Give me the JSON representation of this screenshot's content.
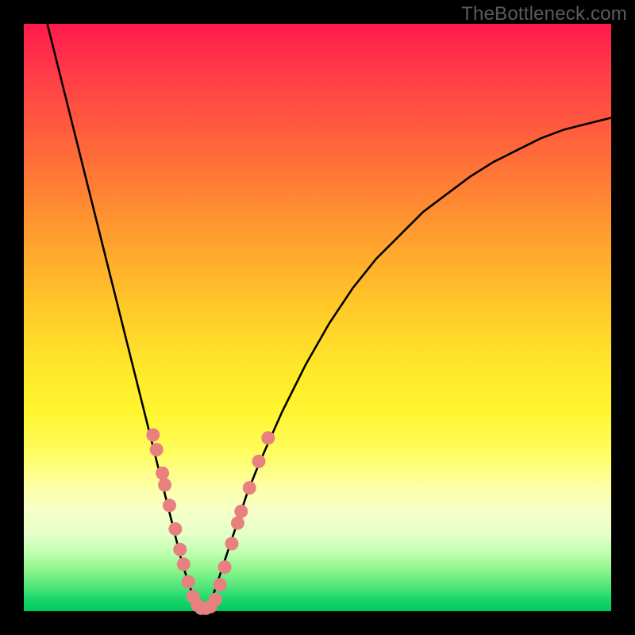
{
  "watermark": "TheBottleneck.com",
  "colors": {
    "frame": "#000000",
    "curve": "#000000",
    "marker_fill": "#e98080",
    "marker_stroke": "#d66a6a"
  },
  "chart_data": {
    "type": "line",
    "title": "",
    "xlabel": "",
    "ylabel": "",
    "xlim": [
      0,
      100
    ],
    "ylim": [
      0,
      100
    ],
    "series": [
      {
        "name": "bottleneck-curve",
        "x": [
          4,
          6,
          8,
          10,
          12,
          14,
          16,
          18,
          20,
          22,
          24,
          26,
          27,
          28,
          29,
          30,
          31,
          32,
          33,
          34,
          36,
          38,
          40,
          44,
          48,
          52,
          56,
          60,
          64,
          68,
          72,
          76,
          80,
          84,
          88,
          92,
          96,
          100
        ],
        "y": [
          100,
          92,
          84,
          76,
          68,
          60,
          52,
          44,
          36,
          28,
          20,
          12,
          8,
          5,
          2,
          0.5,
          0.5,
          2,
          5,
          8,
          14,
          20,
          25,
          34,
          42,
          49,
          55,
          60,
          64,
          68,
          71,
          74,
          76.5,
          78.5,
          80.5,
          82,
          83,
          84
        ]
      }
    ],
    "markers": [
      {
        "x": 22.0,
        "y": 30.0
      },
      {
        "x": 22.6,
        "y": 27.5
      },
      {
        "x": 23.6,
        "y": 23.5
      },
      {
        "x": 24.0,
        "y": 21.5
      },
      {
        "x": 24.8,
        "y": 18.0
      },
      {
        "x": 25.8,
        "y": 14.0
      },
      {
        "x": 26.6,
        "y": 10.5
      },
      {
        "x": 27.2,
        "y": 8.0
      },
      {
        "x": 28.0,
        "y": 5.0
      },
      {
        "x": 28.8,
        "y": 2.5
      },
      {
        "x": 29.6,
        "y": 1.0
      },
      {
        "x": 30.2,
        "y": 0.5
      },
      {
        "x": 31.0,
        "y": 0.5
      },
      {
        "x": 31.8,
        "y": 0.8
      },
      {
        "x": 32.6,
        "y": 2.0
      },
      {
        "x": 33.4,
        "y": 4.5
      },
      {
        "x": 34.2,
        "y": 7.5
      },
      {
        "x": 35.4,
        "y": 11.5
      },
      {
        "x": 36.4,
        "y": 15.0
      },
      {
        "x": 37.0,
        "y": 17.0
      },
      {
        "x": 38.4,
        "y": 21.0
      },
      {
        "x": 40.0,
        "y": 25.5
      },
      {
        "x": 41.6,
        "y": 29.5
      }
    ]
  }
}
